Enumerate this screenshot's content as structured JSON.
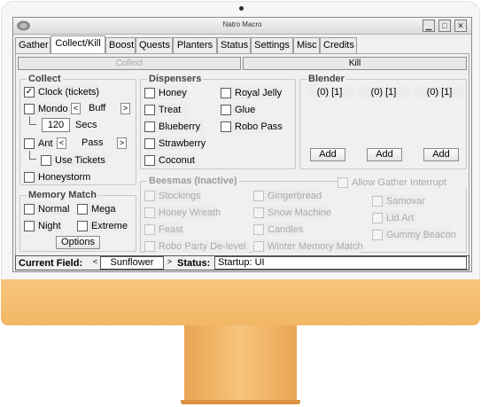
{
  "window": {
    "title": "Natro Macro"
  },
  "tabs": [
    "Gather",
    "Collect/Kill",
    "Boost",
    "Quests",
    "Planters",
    "Status",
    "Settings",
    "Misc",
    "Credits"
  ],
  "toggles": {
    "collect": "Collect",
    "kill": "Kill"
  },
  "collect": {
    "title": "Collect",
    "clock": "Clock (tickets)",
    "mondo": "Mondo",
    "mondo_option": "Buff",
    "secs_value": "120",
    "secs_label": "Secs",
    "ant": "Ant",
    "ant_option": "Pass",
    "use_tickets": "Use Tickets",
    "honeystorm": "Honeystorm"
  },
  "memory_match": {
    "title": "Memory Match",
    "normal": "Normal",
    "mega": "Mega",
    "night": "Night",
    "extreme": "Extreme",
    "options": "Options"
  },
  "dispensers": {
    "title": "Dispensers",
    "honey": "Honey",
    "royal_jelly": "Royal Jelly",
    "treat": "Treat",
    "glue": "Glue",
    "blueberry": "Blueberry",
    "robo_pass": "Robo Pass",
    "strawberry": "Strawberry",
    "coconut": "Coconut"
  },
  "blender": {
    "title": "Blender",
    "slots": [
      "(0) [1]",
      "(0) [1]",
      "(0) [1]"
    ],
    "add": "Add"
  },
  "beesmas": {
    "title": "Beesmas (Inactive)",
    "allow_gather": "Allow Gather Interrupt",
    "stockings": "Stockings",
    "gingerbread": "Gingerbread",
    "samovar": "Samovar",
    "honey_wreath": "Honey Wreath",
    "snow_machine": "Snow Machine",
    "lid_art": "Lid Art",
    "feast": "Feast",
    "candles": "Candles",
    "gummy_beacon": "Gummy Beacon",
    "robo_party": "Robo Party De-level",
    "winter_mm": "Winter Memory Match"
  },
  "status_bar": {
    "current_field_label": "Current Field:",
    "current_field": "Sunflower",
    "status_label": "Status:",
    "status": "Startup: UI"
  },
  "colors": {
    "chin": "#f2b766",
    "stand": "#e9a553"
  }
}
